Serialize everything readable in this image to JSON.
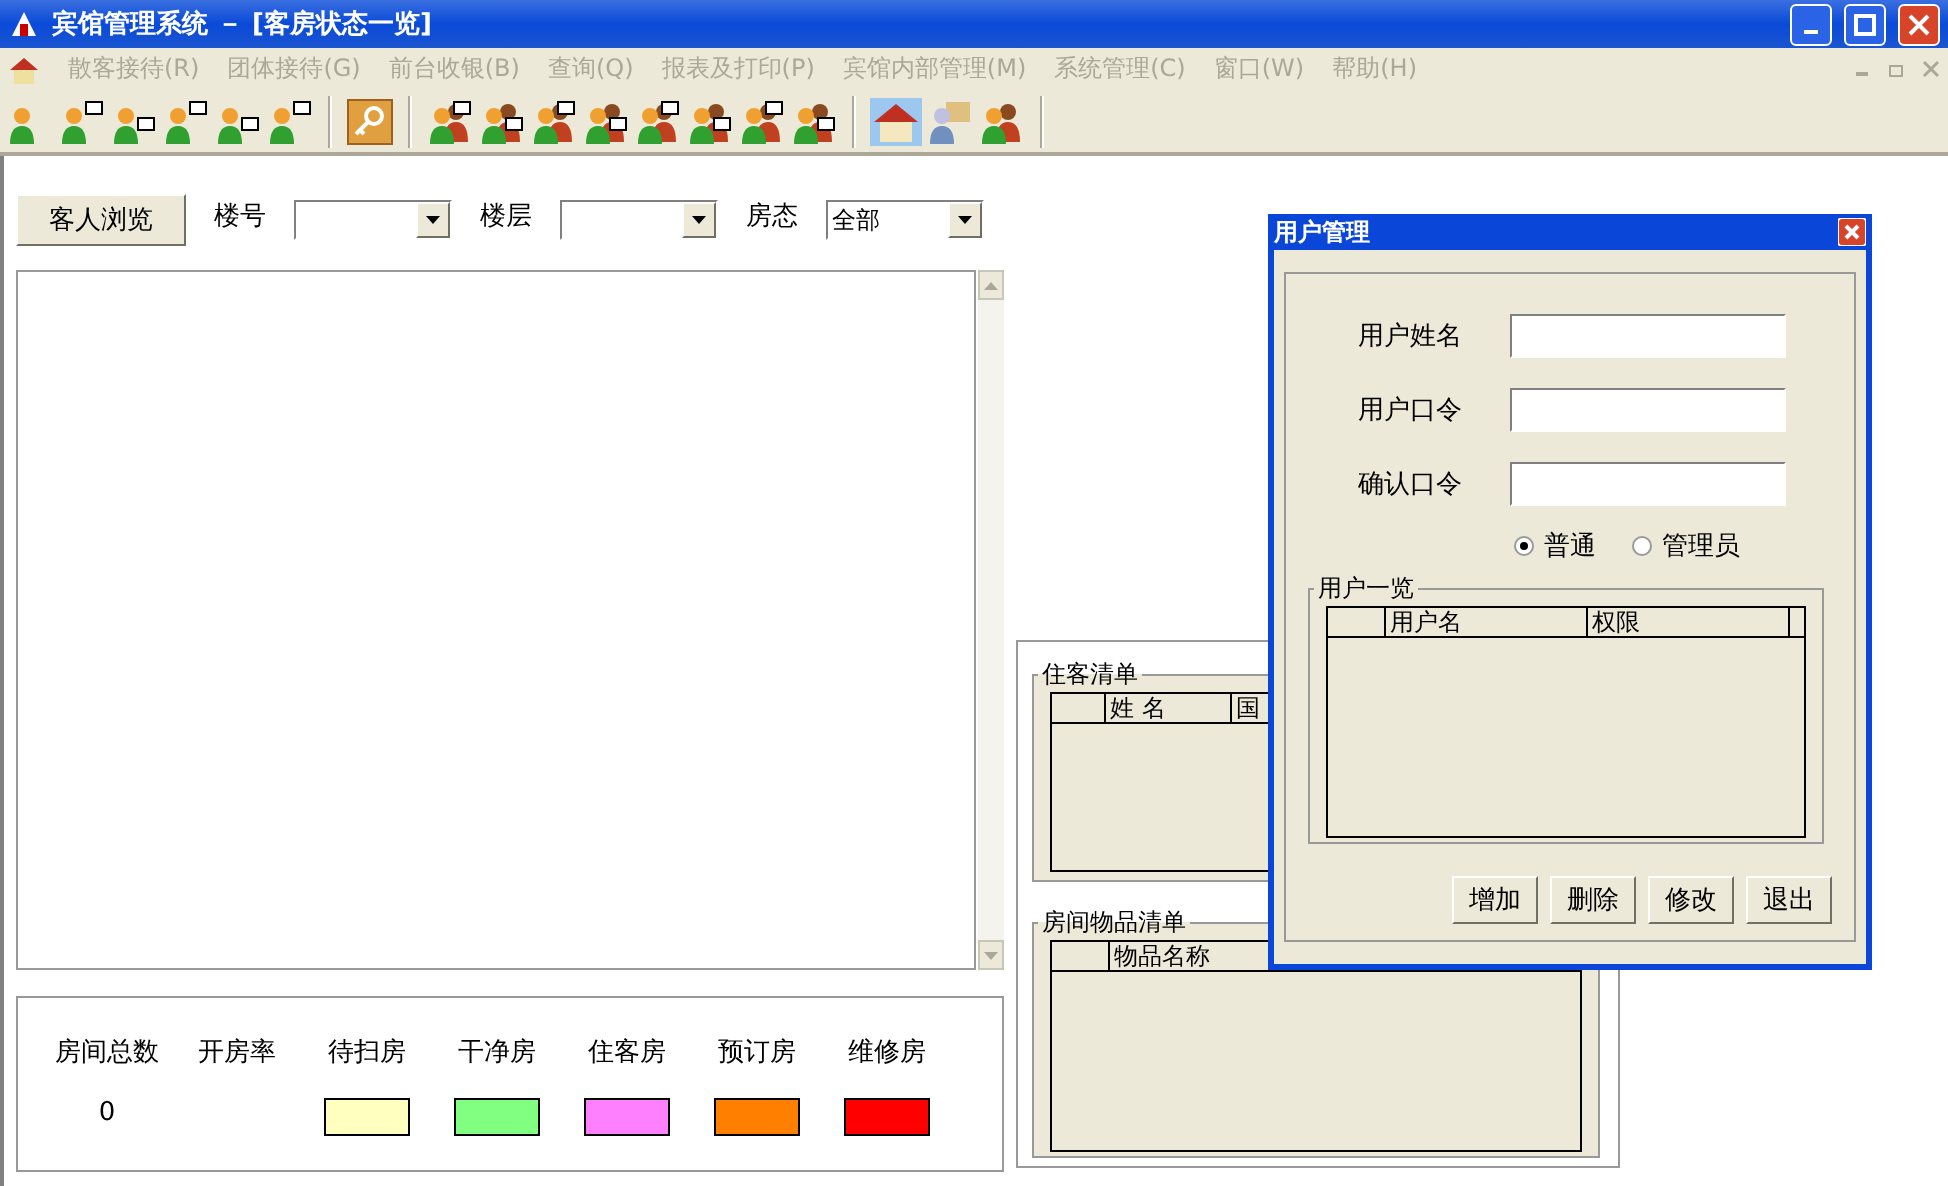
{
  "window": {
    "title": "宾馆管理系统 － [客房状态一览]"
  },
  "menu": [
    {
      "label": "散客接待(R)",
      "disabled": true
    },
    {
      "label": "团体接待(G)",
      "disabled": true
    },
    {
      "label": "前台收银(B)",
      "disabled": true
    },
    {
      "label": "查询(Q)",
      "disabled": true
    },
    {
      "label": "报表及打印(P)",
      "disabled": true
    },
    {
      "label": "宾馆内部管理(M)",
      "disabled": true
    },
    {
      "label": "系统管理(C)",
      "disabled": true
    },
    {
      "label": "窗口(W)",
      "disabled": true
    },
    {
      "label": "帮助(H)",
      "disabled": true
    }
  ],
  "filter_bar": {
    "browse_button": "客人浏览",
    "filters": [
      {
        "label": "楼号"
      },
      {
        "label": "楼层"
      },
      {
        "label": "房态",
        "value": "全部"
      }
    ]
  },
  "legend": [
    {
      "kind": "count",
      "label": "房间总数",
      "value": "0"
    },
    {
      "kind": "count",
      "label": "开房率"
    },
    {
      "kind": "swatch",
      "label": "待扫房",
      "color": "#ffffc0"
    },
    {
      "kind": "swatch",
      "label": "干净房",
      "color": "#80ff80"
    },
    {
      "kind": "swatch",
      "label": "住客房",
      "color": "#ff80ff"
    },
    {
      "kind": "swatch",
      "label": "预订房",
      "color": "#ff8000"
    },
    {
      "kind": "swatch",
      "label": "维修房",
      "color": "#ff0000"
    }
  ],
  "guest_list": {
    "title": "住客清单",
    "columns": [
      "姓 名",
      "国"
    ]
  },
  "item_list": {
    "title": "房间物品清单",
    "columns": [
      "物品名称"
    ]
  },
  "dialog": {
    "title": "用户管理",
    "fields": [
      {
        "label": "用户姓名"
      },
      {
        "label": "用户口令"
      },
      {
        "label": "确认口令"
      }
    ],
    "roles": [
      {
        "label": "普通",
        "selected": true
      },
      {
        "label": "管理员",
        "selected": false
      }
    ],
    "user_list": {
      "title": "用户一览",
      "columns": [
        "用户名",
        "权限"
      ]
    },
    "buttons": [
      "增加",
      "删除",
      "修改",
      "退出"
    ]
  }
}
